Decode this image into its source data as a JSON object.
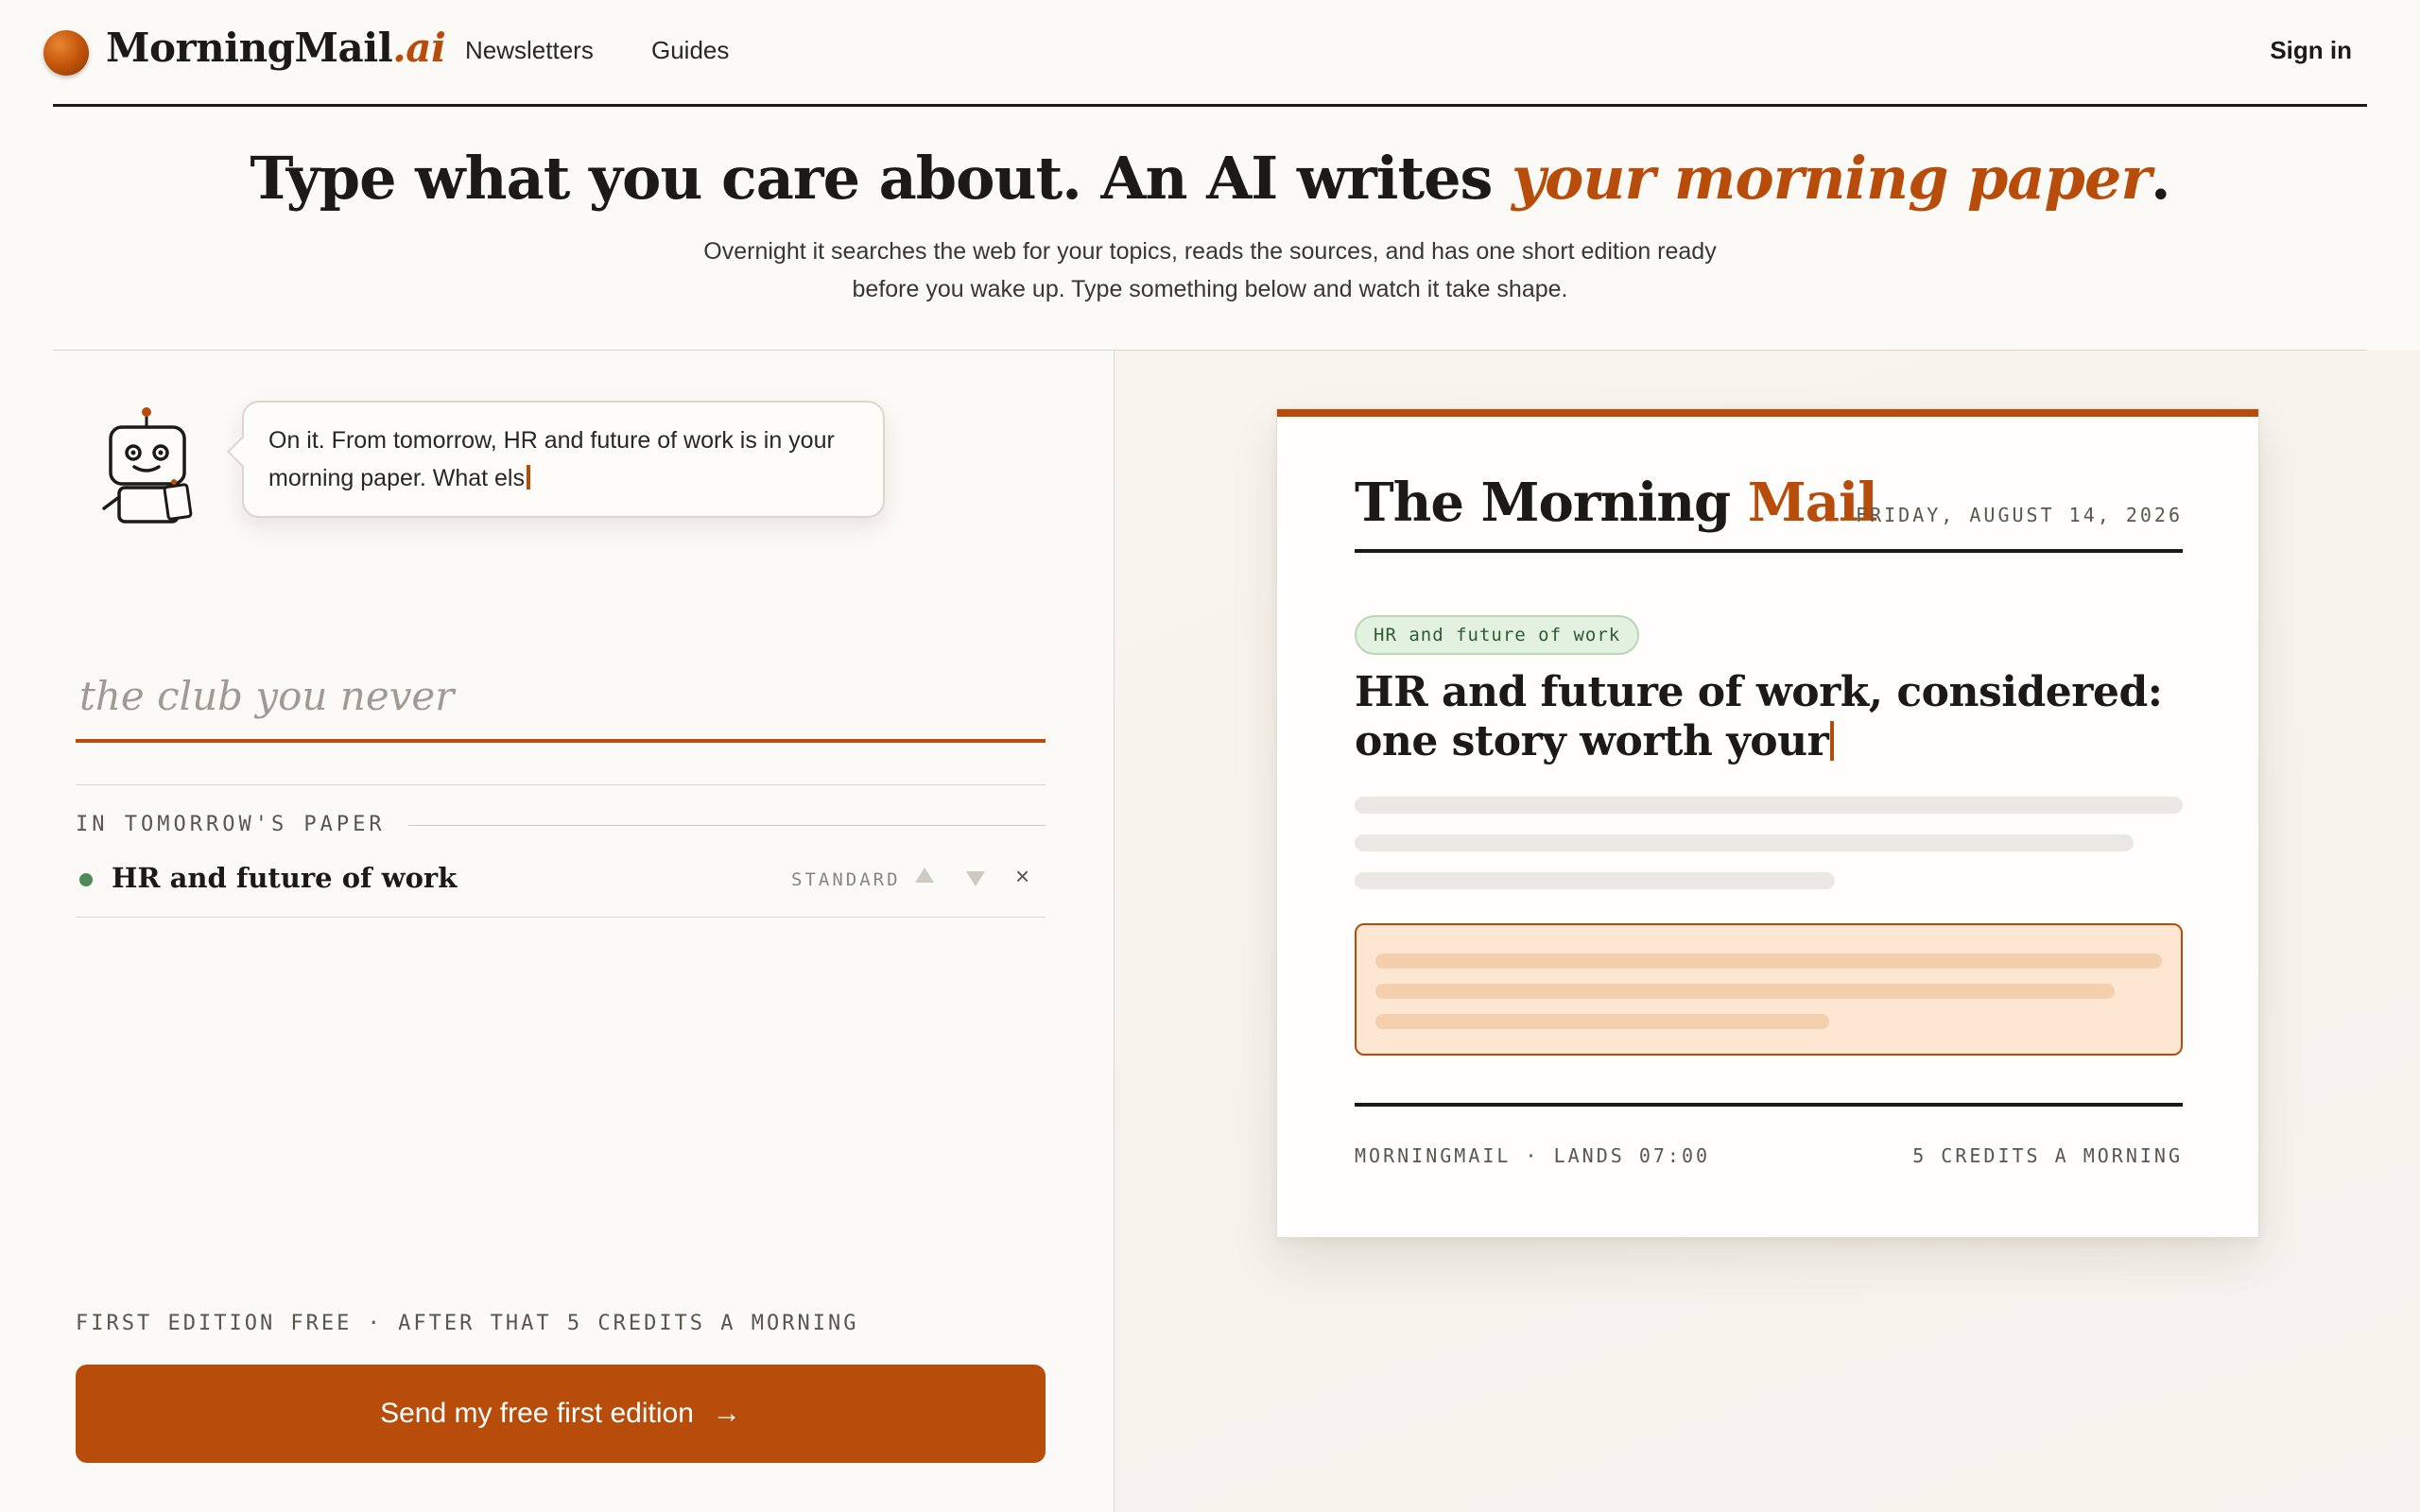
{
  "header": {
    "brand_main": "MorningMail",
    "brand_suffix": ".ai",
    "nav": [
      "Newsletters",
      "Guides"
    ],
    "signin_label": "Sign in"
  },
  "hero": {
    "title_main": "Type what you care about. An AI writes ",
    "title_accent": "your morning paper",
    "title_end": ".",
    "subtitle_line1": "Overnight it searches the web for your topics, reads the sources, and has one short edition ready",
    "subtitle_line2": "before you wake up. Type something below and watch it take shape."
  },
  "assistant": {
    "bubble_text": "On it. From tomorrow, HR and future of work is in your morning paper. What els"
  },
  "topic_input": {
    "placeholder": "the club you never",
    "value": ""
  },
  "list": {
    "label": "IN TOMORROW'S PAPER",
    "items": [
      {
        "name": "HR and future of work",
        "tier": "STANDARD",
        "remove": "×"
      }
    ]
  },
  "pricing": {
    "note": "FIRST EDITION FREE · AFTER THAT 5 CREDITS A MORNING",
    "cta_label": "Send my free first edition",
    "cta_arrow": "→"
  },
  "paper": {
    "title_main": "The Morning ",
    "title_accent": "Mail",
    "date": "FRIDAY, AUGUST 14, 2026",
    "tag": "HR and future of work",
    "headline": "HR and future of work, considered: one story worth your",
    "footer_left": "MORNINGMAIL · LANDS 07:00",
    "footer_right": "5 CREDITS A MORNING"
  },
  "colors": {
    "accent": "#b84d0b",
    "background": "#fcfaf6",
    "tag_green": "#e3f1e1",
    "highlight": "#fde7d2"
  }
}
